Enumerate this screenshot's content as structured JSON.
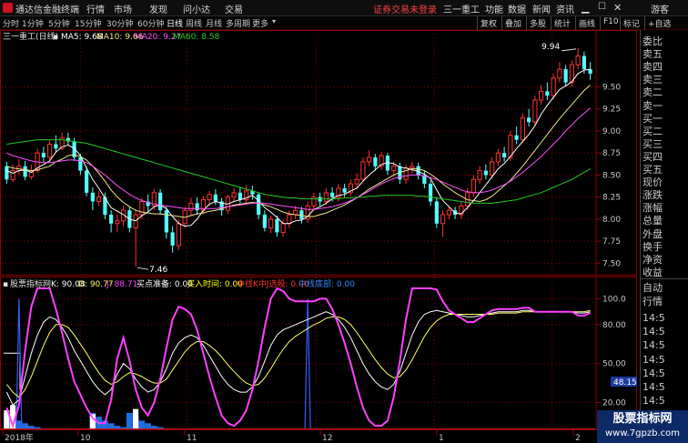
{
  "app": {
    "title": "通达信金融终端",
    "menu": [
      "行情",
      "市场",
      "发现",
      "问小达",
      "交易"
    ],
    "login_notice": "证券交易未登录",
    "stock_name": "三一重工",
    "right_menu": [
      "功能",
      "数据",
      "新闻",
      "资讯"
    ],
    "user": "游客"
  },
  "toolbar": {
    "periods": [
      "分时",
      "1分钟",
      "5分钟",
      "15分钟",
      "30分钟",
      "60分钟",
      "日线",
      "周线",
      "月线",
      "多周期",
      "更多"
    ],
    "active_period": "日线",
    "right_buttons": [
      "复权",
      "叠加",
      "多股",
      "统计",
      "画线",
      "F10",
      "标记",
      "+自选"
    ]
  },
  "price_panel": {
    "header": "三一重工(日线)",
    "ma_labels": [
      "MA5: 9.68",
      "MA10: 9.66",
      "MA20: 9.27",
      "MA60: 8.58"
    ],
    "y_ticks": [
      "9.50",
      "9.25",
      "9.00",
      "8.75",
      "8.50",
      "8.25",
      "8.00",
      "7.75",
      "7.50"
    ],
    "high_label": "9.94",
    "low_label": "7.46",
    "y_range": [
      7.38,
      10.0
    ]
  },
  "indicator_panel": {
    "name": "股票指标网",
    "labels": [
      "K: 90.08",
      "D: 90.77",
      "J: 88.71",
      "买点准备: 0.00",
      "买入时间: 0.00",
      "中线K中J选股: 0.00",
      "中线底部: 0.00"
    ],
    "y_ticks": [
      "100.0",
      "80.00",
      "50.00",
      "20.00"
    ],
    "value_box": "48.15",
    "y_range": [
      0,
      108
    ]
  },
  "x_axis": {
    "labels": [
      "2018年",
      "10",
      "11",
      "12",
      "1",
      "2"
    ]
  },
  "side_panel": {
    "order_book": [
      "委比",
      "卖五",
      "卖四",
      "卖三",
      "卖二",
      "卖一",
      "买一",
      "买二",
      "买三",
      "买四",
      "买五",
      "现价",
      "涨跌",
      "涨幅",
      "总量",
      "外盘",
      "换手",
      "净资",
      "收益"
    ],
    "ticks_header": [
      "自动",
      "行情"
    ],
    "ticks": [
      "14:5",
      "14:5",
      "14:5",
      "14:5",
      "14:5",
      "14:5",
      "14:5",
      "14:5",
      "14:5",
      "14:5"
    ]
  },
  "watermark": {
    "line1": "股票指标网",
    "line2": "www.7gpzb.com"
  },
  "colors": {
    "up": "#ff3232",
    "down": "#54ffff",
    "ma5": "#ffffff",
    "ma10": "#f0e68c",
    "ma20": "#ff50ff",
    "ma60": "#22cc22",
    "k": "#ffffff",
    "d": "#ffff66",
    "j": "#ff40ff",
    "grid": "#8a0000",
    "bar_blue": "#1e6fe0"
  },
  "chart_data": {
    "type": "candlestick",
    "candles": [
      [
        8.6,
        8.45,
        8.65,
        8.4
      ],
      [
        8.45,
        8.55,
        8.62,
        8.42
      ],
      [
        8.55,
        8.6,
        8.68,
        8.5
      ],
      [
        8.6,
        8.48,
        8.66,
        8.44
      ],
      [
        8.48,
        8.55,
        8.62,
        8.45
      ],
      [
        8.55,
        8.75,
        8.8,
        8.52
      ],
      [
        8.75,
        8.7,
        8.82,
        8.65
      ],
      [
        8.7,
        8.85,
        8.9,
        8.66
      ],
      [
        8.85,
        8.8,
        8.95,
        8.76
      ],
      [
        8.8,
        8.92,
        8.98,
        8.78
      ],
      [
        8.92,
        8.88,
        8.98,
        8.84
      ],
      [
        8.88,
        8.7,
        8.92,
        8.66
      ],
      [
        8.7,
        8.55,
        8.74,
        8.5
      ],
      [
        8.55,
        8.3,
        8.6,
        8.26
      ],
      [
        8.3,
        8.2,
        8.36,
        8.1
      ],
      [
        8.2,
        8.25,
        8.32,
        8.15
      ],
      [
        8.25,
        8.05,
        8.3,
        8.0
      ],
      [
        8.05,
        7.95,
        8.1,
        7.85
      ],
      [
        7.95,
        7.98,
        8.05,
        7.85
      ],
      [
        7.98,
        8.1,
        8.15,
        7.92
      ],
      [
        8.1,
        7.9,
        8.14,
        7.85
      ],
      [
        7.9,
        8.05,
        8.1,
        7.46
      ],
      [
        8.05,
        8.2,
        8.24,
        8.0
      ],
      [
        8.2,
        8.15,
        8.28,
        8.08
      ],
      [
        8.15,
        8.3,
        8.34,
        8.1
      ],
      [
        8.3,
        8.1,
        8.34,
        8.05
      ],
      [
        8.1,
        7.85,
        8.14,
        7.78
      ],
      [
        7.85,
        7.7,
        7.92,
        7.62
      ],
      [
        7.7,
        7.95,
        8.0,
        7.65
      ],
      [
        7.95,
        8.1,
        8.14,
        7.9
      ],
      [
        8.1,
        8.18,
        8.24,
        8.04
      ],
      [
        8.18,
        8.1,
        8.25,
        8.05
      ],
      [
        8.1,
        8.22,
        8.26,
        8.06
      ],
      [
        8.22,
        8.28,
        8.32,
        8.15
      ],
      [
        8.28,
        8.2,
        8.34,
        8.16
      ],
      [
        8.2,
        8.1,
        8.24,
        8.04
      ],
      [
        8.1,
        8.25,
        8.28,
        8.06
      ],
      [
        8.25,
        8.3,
        8.35,
        8.2
      ],
      [
        8.3,
        8.22,
        8.36,
        8.18
      ],
      [
        8.22,
        8.32,
        8.38,
        8.18
      ],
      [
        8.32,
        8.28,
        8.38,
        8.22
      ],
      [
        8.28,
        8.05,
        8.3,
        8.0
      ],
      [
        8.05,
        7.9,
        8.1,
        7.86
      ],
      [
        7.9,
        8.0,
        8.04,
        7.84
      ],
      [
        8.0,
        7.85,
        8.04,
        7.8
      ],
      [
        7.85,
        7.95,
        8.0,
        7.8
      ],
      [
        7.95,
        8.05,
        8.1,
        7.9
      ],
      [
        8.05,
        8.1,
        8.15,
        8.0
      ],
      [
        8.1,
        8.0,
        8.14,
        7.95
      ],
      [
        8.0,
        8.15,
        8.2,
        7.96
      ],
      [
        8.15,
        8.25,
        8.3,
        8.1
      ],
      [
        8.25,
        8.2,
        8.3,
        8.15
      ],
      [
        8.2,
        8.3,
        8.35,
        8.16
      ],
      [
        8.3,
        8.25,
        8.36,
        8.2
      ],
      [
        8.25,
        8.35,
        8.4,
        8.2
      ],
      [
        8.35,
        8.3,
        8.4,
        8.25
      ],
      [
        8.3,
        8.4,
        8.45,
        8.26
      ],
      [
        8.4,
        8.45,
        8.52,
        8.35
      ],
      [
        8.45,
        8.65,
        8.7,
        8.42
      ],
      [
        8.65,
        8.7,
        8.78,
        8.6
      ],
      [
        8.7,
        8.6,
        8.74,
        8.55
      ],
      [
        8.6,
        8.72,
        8.76,
        8.56
      ],
      [
        8.72,
        8.55,
        8.75,
        8.5
      ],
      [
        8.55,
        8.6,
        8.65,
        8.48
      ],
      [
        8.6,
        8.45,
        8.64,
        8.4
      ],
      [
        8.45,
        8.58,
        8.62,
        8.4
      ],
      [
        8.58,
        8.6,
        8.65,
        8.52
      ],
      [
        8.6,
        8.5,
        8.64,
        8.45
      ],
      [
        8.5,
        8.4,
        8.55,
        8.35
      ],
      [
        8.4,
        8.2,
        8.44,
        8.15
      ],
      [
        8.2,
        7.95,
        8.25,
        7.9
      ],
      [
        7.95,
        8.05,
        8.1,
        7.8
      ],
      [
        8.05,
        8.1,
        8.15,
        8.0
      ],
      [
        8.1,
        8.05,
        8.14,
        8.0
      ],
      [
        8.05,
        8.15,
        8.2,
        8.0
      ],
      [
        8.15,
        8.3,
        8.35,
        8.1
      ],
      [
        8.3,
        8.45,
        8.5,
        8.25
      ],
      [
        8.45,
        8.55,
        8.6,
        8.4
      ],
      [
        8.55,
        8.5,
        8.62,
        8.45
      ],
      [
        8.5,
        8.65,
        8.7,
        8.46
      ],
      [
        8.65,
        8.75,
        8.8,
        8.6
      ],
      [
        8.75,
        8.7,
        8.82,
        8.65
      ],
      [
        8.7,
        8.95,
        9.0,
        8.66
      ],
      [
        8.95,
        8.9,
        9.05,
        8.85
      ],
      [
        8.9,
        9.15,
        9.2,
        8.86
      ],
      [
        9.15,
        9.1,
        9.25,
        9.05
      ],
      [
        9.1,
        9.35,
        9.4,
        9.06
      ],
      [
        9.35,
        9.45,
        9.52,
        9.3
      ],
      [
        9.45,
        9.4,
        9.55,
        9.35
      ],
      [
        9.4,
        9.6,
        9.65,
        9.36
      ],
      [
        9.6,
        9.7,
        9.78,
        9.55
      ],
      [
        9.7,
        9.55,
        9.75,
        9.5
      ],
      [
        9.55,
        9.75,
        9.8,
        9.5
      ],
      [
        9.75,
        9.85,
        9.94,
        9.7
      ],
      [
        9.85,
        9.7,
        9.9,
        9.65
      ],
      [
        9.7,
        9.65,
        9.78,
        9.58
      ]
    ],
    "ma": {
      "MA5": [
        8.55,
        8.52,
        8.55,
        8.56,
        8.53,
        8.58,
        8.62,
        8.66,
        8.76,
        8.82,
        8.84,
        8.8,
        8.72,
        8.58,
        8.45,
        8.35,
        8.24,
        8.13,
        8.09,
        8.05,
        8.0,
        7.98,
        8.04,
        8.08,
        8.14,
        8.16,
        8.12,
        8.03,
        7.95,
        7.92,
        7.93,
        8.0,
        8.1,
        8.17,
        8.2,
        8.18,
        8.17,
        8.2,
        8.22,
        8.24,
        8.27,
        8.21,
        8.13,
        8.08,
        8.02,
        7.95,
        7.95,
        7.98,
        7.99,
        8.03,
        8.11,
        8.14,
        8.18,
        8.23,
        8.27,
        8.28,
        8.32,
        8.35,
        8.43,
        8.5,
        8.56,
        8.62,
        8.64,
        8.63,
        8.59,
        8.58,
        8.56,
        8.54,
        8.51,
        8.46,
        8.33,
        8.21,
        8.14,
        8.07,
        8.06,
        8.13,
        8.21,
        8.3,
        8.39,
        8.48,
        8.57,
        8.63,
        8.71,
        8.8,
        8.88,
        8.96,
        9.06,
        9.19,
        9.29,
        9.38,
        9.47,
        9.51,
        9.56,
        9.65,
        9.69,
        9.7
      ],
      "MA10": [
        8.6,
        8.58,
        8.57,
        8.56,
        8.55,
        8.56,
        8.58,
        8.6,
        8.65,
        8.68,
        8.72,
        8.73,
        8.71,
        8.67,
        8.6,
        8.52,
        8.43,
        8.33,
        8.25,
        8.19,
        8.14,
        8.1,
        8.08,
        8.07,
        8.06,
        8.06,
        8.05,
        8.04,
        8.03,
        8.02,
        8.04,
        8.06,
        8.07,
        8.09,
        8.1,
        8.12,
        8.14,
        8.16,
        8.17,
        8.18,
        8.19,
        8.18,
        8.16,
        8.14,
        8.11,
        8.08,
        8.06,
        8.05,
        8.04,
        8.03,
        8.03,
        8.05,
        8.07,
        8.1,
        8.13,
        8.16,
        8.2,
        8.24,
        8.29,
        8.34,
        8.38,
        8.42,
        8.46,
        8.5,
        8.53,
        8.55,
        8.57,
        8.57,
        8.55,
        8.51,
        8.46,
        8.4,
        8.35,
        8.3,
        8.26,
        8.22,
        8.21,
        8.2,
        8.22,
        8.26,
        8.32,
        8.38,
        8.44,
        8.52,
        8.6,
        8.69,
        8.78,
        8.87,
        8.96,
        9.05,
        9.14,
        9.22,
        9.3,
        9.38,
        9.46,
        9.52
      ],
      "MA20": [
        8.75,
        8.72,
        8.7,
        8.68,
        8.66,
        8.65,
        8.64,
        8.64,
        8.65,
        8.66,
        8.67,
        8.67,
        8.66,
        8.64,
        8.6,
        8.55,
        8.5,
        8.44,
        8.38,
        8.33,
        8.28,
        8.24,
        8.21,
        8.19,
        8.17,
        8.16,
        8.15,
        8.14,
        8.13,
        8.12,
        8.12,
        8.12,
        8.12,
        8.12,
        8.12,
        8.13,
        8.14,
        8.15,
        8.16,
        8.17,
        8.18,
        8.18,
        8.18,
        8.17,
        8.16,
        8.15,
        8.14,
        8.13,
        8.12,
        8.11,
        8.11,
        8.12,
        8.13,
        8.14,
        8.16,
        8.18,
        8.21,
        8.24,
        8.28,
        8.32,
        8.36,
        8.4,
        8.43,
        8.46,
        8.48,
        8.49,
        8.5,
        8.5,
        8.49,
        8.47,
        8.45,
        8.42,
        8.39,
        8.36,
        8.33,
        8.31,
        8.3,
        8.3,
        8.31,
        8.33,
        8.36,
        8.39,
        8.43,
        8.48,
        8.53,
        8.59,
        8.65,
        8.71,
        8.78,
        8.85,
        8.92,
        9.0,
        9.07,
        9.14,
        9.2,
        9.26
      ],
      "MA60": [
        8.85,
        8.86,
        8.87,
        8.88,
        8.89,
        8.9,
        8.9,
        8.9,
        8.9,
        8.9,
        8.89,
        8.88,
        8.87,
        8.86,
        8.84,
        8.82,
        8.8,
        8.78,
        8.76,
        8.74,
        8.72,
        8.7,
        8.68,
        8.66,
        8.64,
        8.62,
        8.6,
        8.58,
        8.56,
        8.54,
        8.52,
        8.5,
        8.48,
        8.46,
        8.44,
        8.42,
        8.4,
        8.38,
        8.36,
        8.34,
        8.32,
        8.3,
        8.28,
        8.27,
        8.26,
        8.25,
        8.24,
        8.24,
        8.23,
        8.23,
        8.23,
        8.23,
        8.23,
        8.23,
        8.23,
        8.24,
        8.24,
        8.25,
        8.25,
        8.26,
        8.26,
        8.27,
        8.27,
        8.27,
        8.27,
        8.27,
        8.27,
        8.26,
        8.26,
        8.25,
        8.24,
        8.23,
        8.22,
        8.21,
        8.2,
        8.19,
        8.18,
        8.18,
        8.18,
        8.18,
        8.19,
        8.2,
        8.21,
        8.22,
        8.24,
        8.26,
        8.28,
        8.3,
        8.33,
        8.36,
        8.39,
        8.42,
        8.45,
        8.49,
        8.53,
        8.57
      ]
    },
    "kdj": {
      "K": [
        28,
        18,
        22,
        40,
        58,
        72,
        82,
        86,
        84,
        78,
        70,
        60,
        52,
        44,
        36,
        30,
        26,
        30,
        42,
        50,
        46,
        38,
        32,
        28,
        30,
        36,
        46,
        58,
        66,
        70,
        72,
        70,
        64,
        56,
        48,
        40,
        34,
        30,
        28,
        28,
        32,
        40,
        52,
        64,
        72,
        76,
        78,
        80,
        82,
        84,
        86,
        88,
        90,
        88,
        84,
        78,
        70,
        60,
        50,
        42,
        36,
        32,
        30,
        34,
        44,
        58,
        72,
        82,
        88,
        90,
        91,
        90,
        89,
        88,
        87,
        86,
        86,
        87,
        88,
        89,
        90,
        90,
        90,
        90,
        91,
        91,
        90,
        90,
        90,
        90,
        90,
        90,
        90,
        89,
        89,
        90
      ],
      "D": [
        34,
        28,
        24,
        30,
        40,
        52,
        64,
        74,
        80,
        80,
        78,
        72,
        65,
        58,
        50,
        43,
        37,
        34,
        36,
        40,
        43,
        42,
        40,
        37,
        35,
        35,
        38,
        45,
        52,
        59,
        64,
        67,
        67,
        64,
        60,
        55,
        49,
        44,
        39,
        35,
        33,
        34,
        39,
        46,
        54,
        61,
        67,
        71,
        74,
        77,
        80,
        82,
        85,
        86,
        86,
        84,
        80,
        74,
        67,
        60,
        53,
        47,
        42,
        39,
        40,
        45,
        53,
        62,
        71,
        78,
        83,
        86,
        88,
        88,
        88,
        88,
        88,
        88,
        88,
        88,
        89,
        89,
        89,
        89,
        90,
        90,
        90,
        90,
        90,
        90,
        90,
        90,
        90,
        90,
        90,
        91
      ],
      "J": [
        16,
        2,
        18,
        60,
        94,
        110,
        118,
        110,
        92,
        74,
        54,
        36,
        26,
        16,
        8,
        4,
        4,
        22,
        54,
        70,
        52,
        30,
        16,
        10,
        20,
        38,
        62,
        84,
        94,
        92,
        88,
        76,
        58,
        40,
        24,
        10,
        4,
        2,
        6,
        14,
        30,
        52,
        78,
        100,
        108,
        106,
        100,
        98,
        98,
        98,
        98,
        100,
        100,
        92,
        80,
        66,
        50,
        32,
        16,
        6,
        2,
        2,
        6,
        24,
        52,
        84,
        110,
        122,
        122,
        114,
        107,
        98,
        91,
        88,
        85,
        82,
        82,
        85,
        88,
        91,
        92,
        92,
        92,
        92,
        93,
        93,
        90,
        90,
        90,
        90,
        90,
        90,
        90,
        87,
        87,
        89
      ]
    },
    "blue_bars": {
      "start_indices": [
        0,
        14,
        20
      ],
      "profile": [
        12,
        9,
        6,
        4,
        2,
        1
      ]
    },
    "white_bars": {
      "indices": [
        0,
        1,
        14,
        21
      ],
      "heights": [
        14,
        18,
        11,
        15
      ]
    },
    "signal_spikes": {
      "indices": [
        2,
        49
      ]
    }
  }
}
